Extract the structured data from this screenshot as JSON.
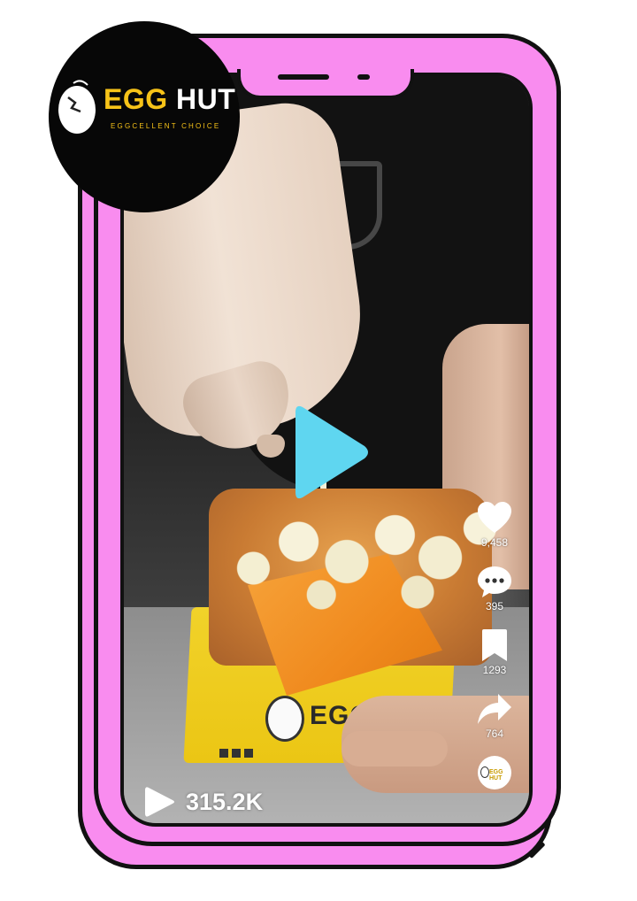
{
  "brand": {
    "name_part1": "EGG",
    "name_part2": "HUT",
    "tagline": "EGGCELLENT CHOICE",
    "box_print": "EGG H"
  },
  "video": {
    "views": "315.2K"
  },
  "actions": [
    {
      "icon": "heart-icon",
      "count": "9,458"
    },
    {
      "icon": "comment-icon",
      "count": "395"
    },
    {
      "icon": "bookmark-icon",
      "count": "1293"
    },
    {
      "icon": "share-icon",
      "count": "764"
    }
  ],
  "avatar": {
    "label": "EGG HUT"
  },
  "colors": {
    "frame_pink": "#f98cef",
    "play_blue": "#5fd6f0",
    "brand_yellow": "#f7c318",
    "badge_black": "#070707"
  }
}
